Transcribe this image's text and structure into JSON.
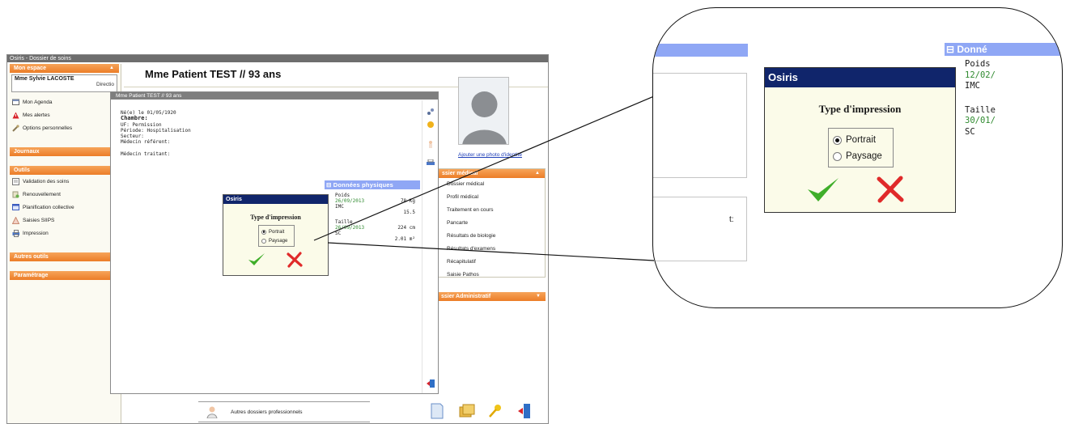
{
  "app": {
    "title": "Osiris - Dossier de soins"
  },
  "sidebar": {
    "mon_espace": "Mon espace",
    "user_name": "Mme Sylvie LACOSTE",
    "user_role": "Directio",
    "items_top": [
      {
        "label": "Mon Agenda",
        "icon": "calendar-icon"
      },
      {
        "label": "Mes alertes",
        "icon": "alert-icon"
      },
      {
        "label": "Options personnelles",
        "icon": "wrench-icon"
      }
    ],
    "journaux": "Journaux",
    "outils": "Outils",
    "items_outils": [
      {
        "label": "Validation des soins",
        "icon": "validation-icon"
      },
      {
        "label": "Renouvellement",
        "icon": "renew-icon"
      },
      {
        "label": "Planification collective",
        "icon": "planning-icon"
      },
      {
        "label": "Saisies SIIPS",
        "icon": "siips-icon"
      },
      {
        "label": "Impression",
        "icon": "printer-icon"
      }
    ],
    "autres_outils": "Autres outils",
    "parametrage": "Paramétrage"
  },
  "header": {
    "patient": "Mme Patient TEST  // 93 ans"
  },
  "photo": {
    "link": "Ajouter une photo d'identité"
  },
  "dossier_medical": {
    "title": "ssier médical",
    "items": [
      "Dossier médical",
      "Profil médical",
      "Traitement en cours",
      "Pancarte",
      "Résultats de biologie",
      "Résultats d'examens",
      "Récapitulatif",
      "Saisie Pathos"
    ]
  },
  "dossier_admin": {
    "title": "ssier Administratif"
  },
  "autres_dossiers": "Autres dossiers professionnels",
  "patient_window": {
    "title": "Mme Patient TEST // 93 ans",
    "born": "Né(e) le 01/05/1920",
    "chambre": "Chambre:",
    "uf": "UF: Permission",
    "periode": "Période: Hospitalisation",
    "secteur": "Secteur:",
    "medecin_ref": "Médecin référent:",
    "medecin_trait": "Médecin traitant:"
  },
  "donnees_physiques": {
    "title": "Données physiques",
    "poids_label": "Poids",
    "poids_date": "26/09/2013",
    "poids_value": "78 Kg",
    "imc_label": "IMC",
    "imc_value": "15.5",
    "taille_label": "Taille",
    "taille_date": "26/09/2013",
    "taille_value": "224 cm",
    "sc_label": "SC",
    "sc_value": "2.01 m²"
  },
  "dialog": {
    "title": "Osiris",
    "heading": "Type d'impression",
    "option_portrait": "Portrait",
    "option_paysage": "Paysage",
    "selected": "Portrait",
    "ok_icon": "checkmark-icon",
    "cancel_icon": "cross-icon"
  },
  "zoom": {
    "phys_title": "Donné",
    "poids_label": "Poids",
    "poids_date": "12/02/",
    "imc_label": "IMC",
    "taille_label": "Taille",
    "taille_date": "30/01/",
    "sc_label": "SC",
    "bg_box_text": "t:"
  },
  "colors": {
    "accent_orange": "#ec7d28",
    "dialog_title": "#10256b",
    "phys_header": "#8fa7f5",
    "date_green": "#2f8a2f"
  }
}
